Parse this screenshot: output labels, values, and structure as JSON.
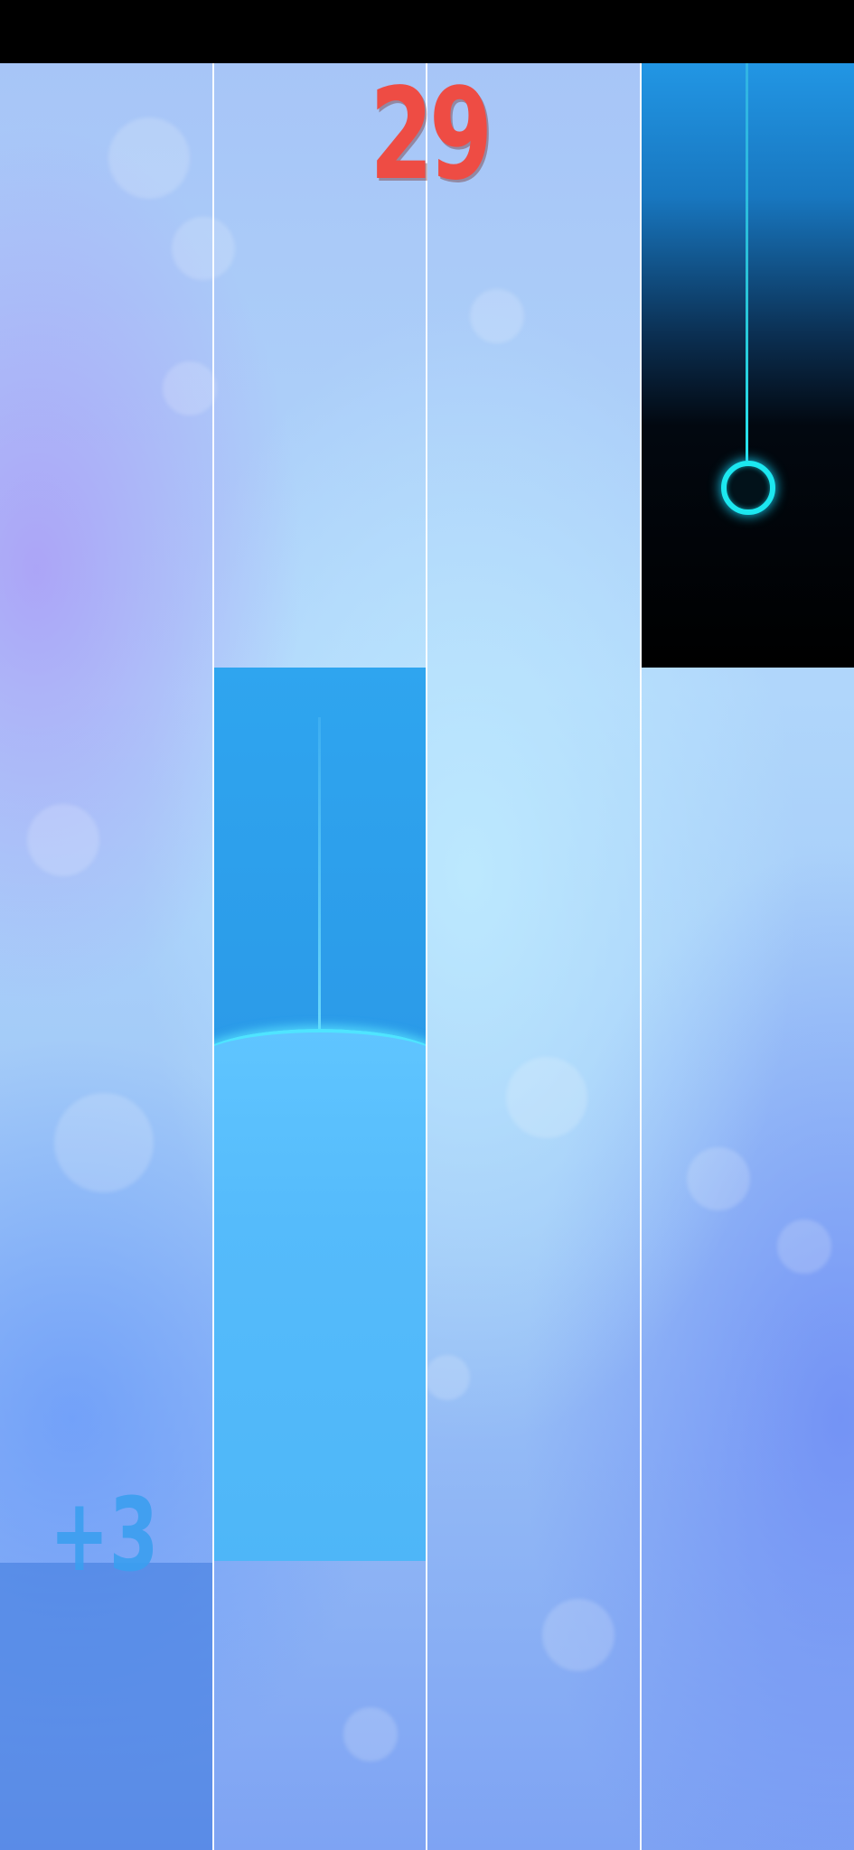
{
  "game": {
    "title": "",
    "score": "29",
    "bonus": "+3",
    "lanes": 4,
    "tiles": [
      {
        "type": "hold",
        "lane": 2,
        "state": "being-held"
      },
      {
        "type": "tap",
        "lane": 4,
        "state": "pending"
      }
    ]
  },
  "colors": {
    "score": "#ee4c44",
    "bonus": "#3b9ff0",
    "hold_tile": "#30a2ee",
    "hold_fill": "#55bbfb",
    "black_tile": "#000000",
    "ring": "#1ce7f0"
  },
  "icons": {
    "tap_target": "circle-ring-icon"
  }
}
